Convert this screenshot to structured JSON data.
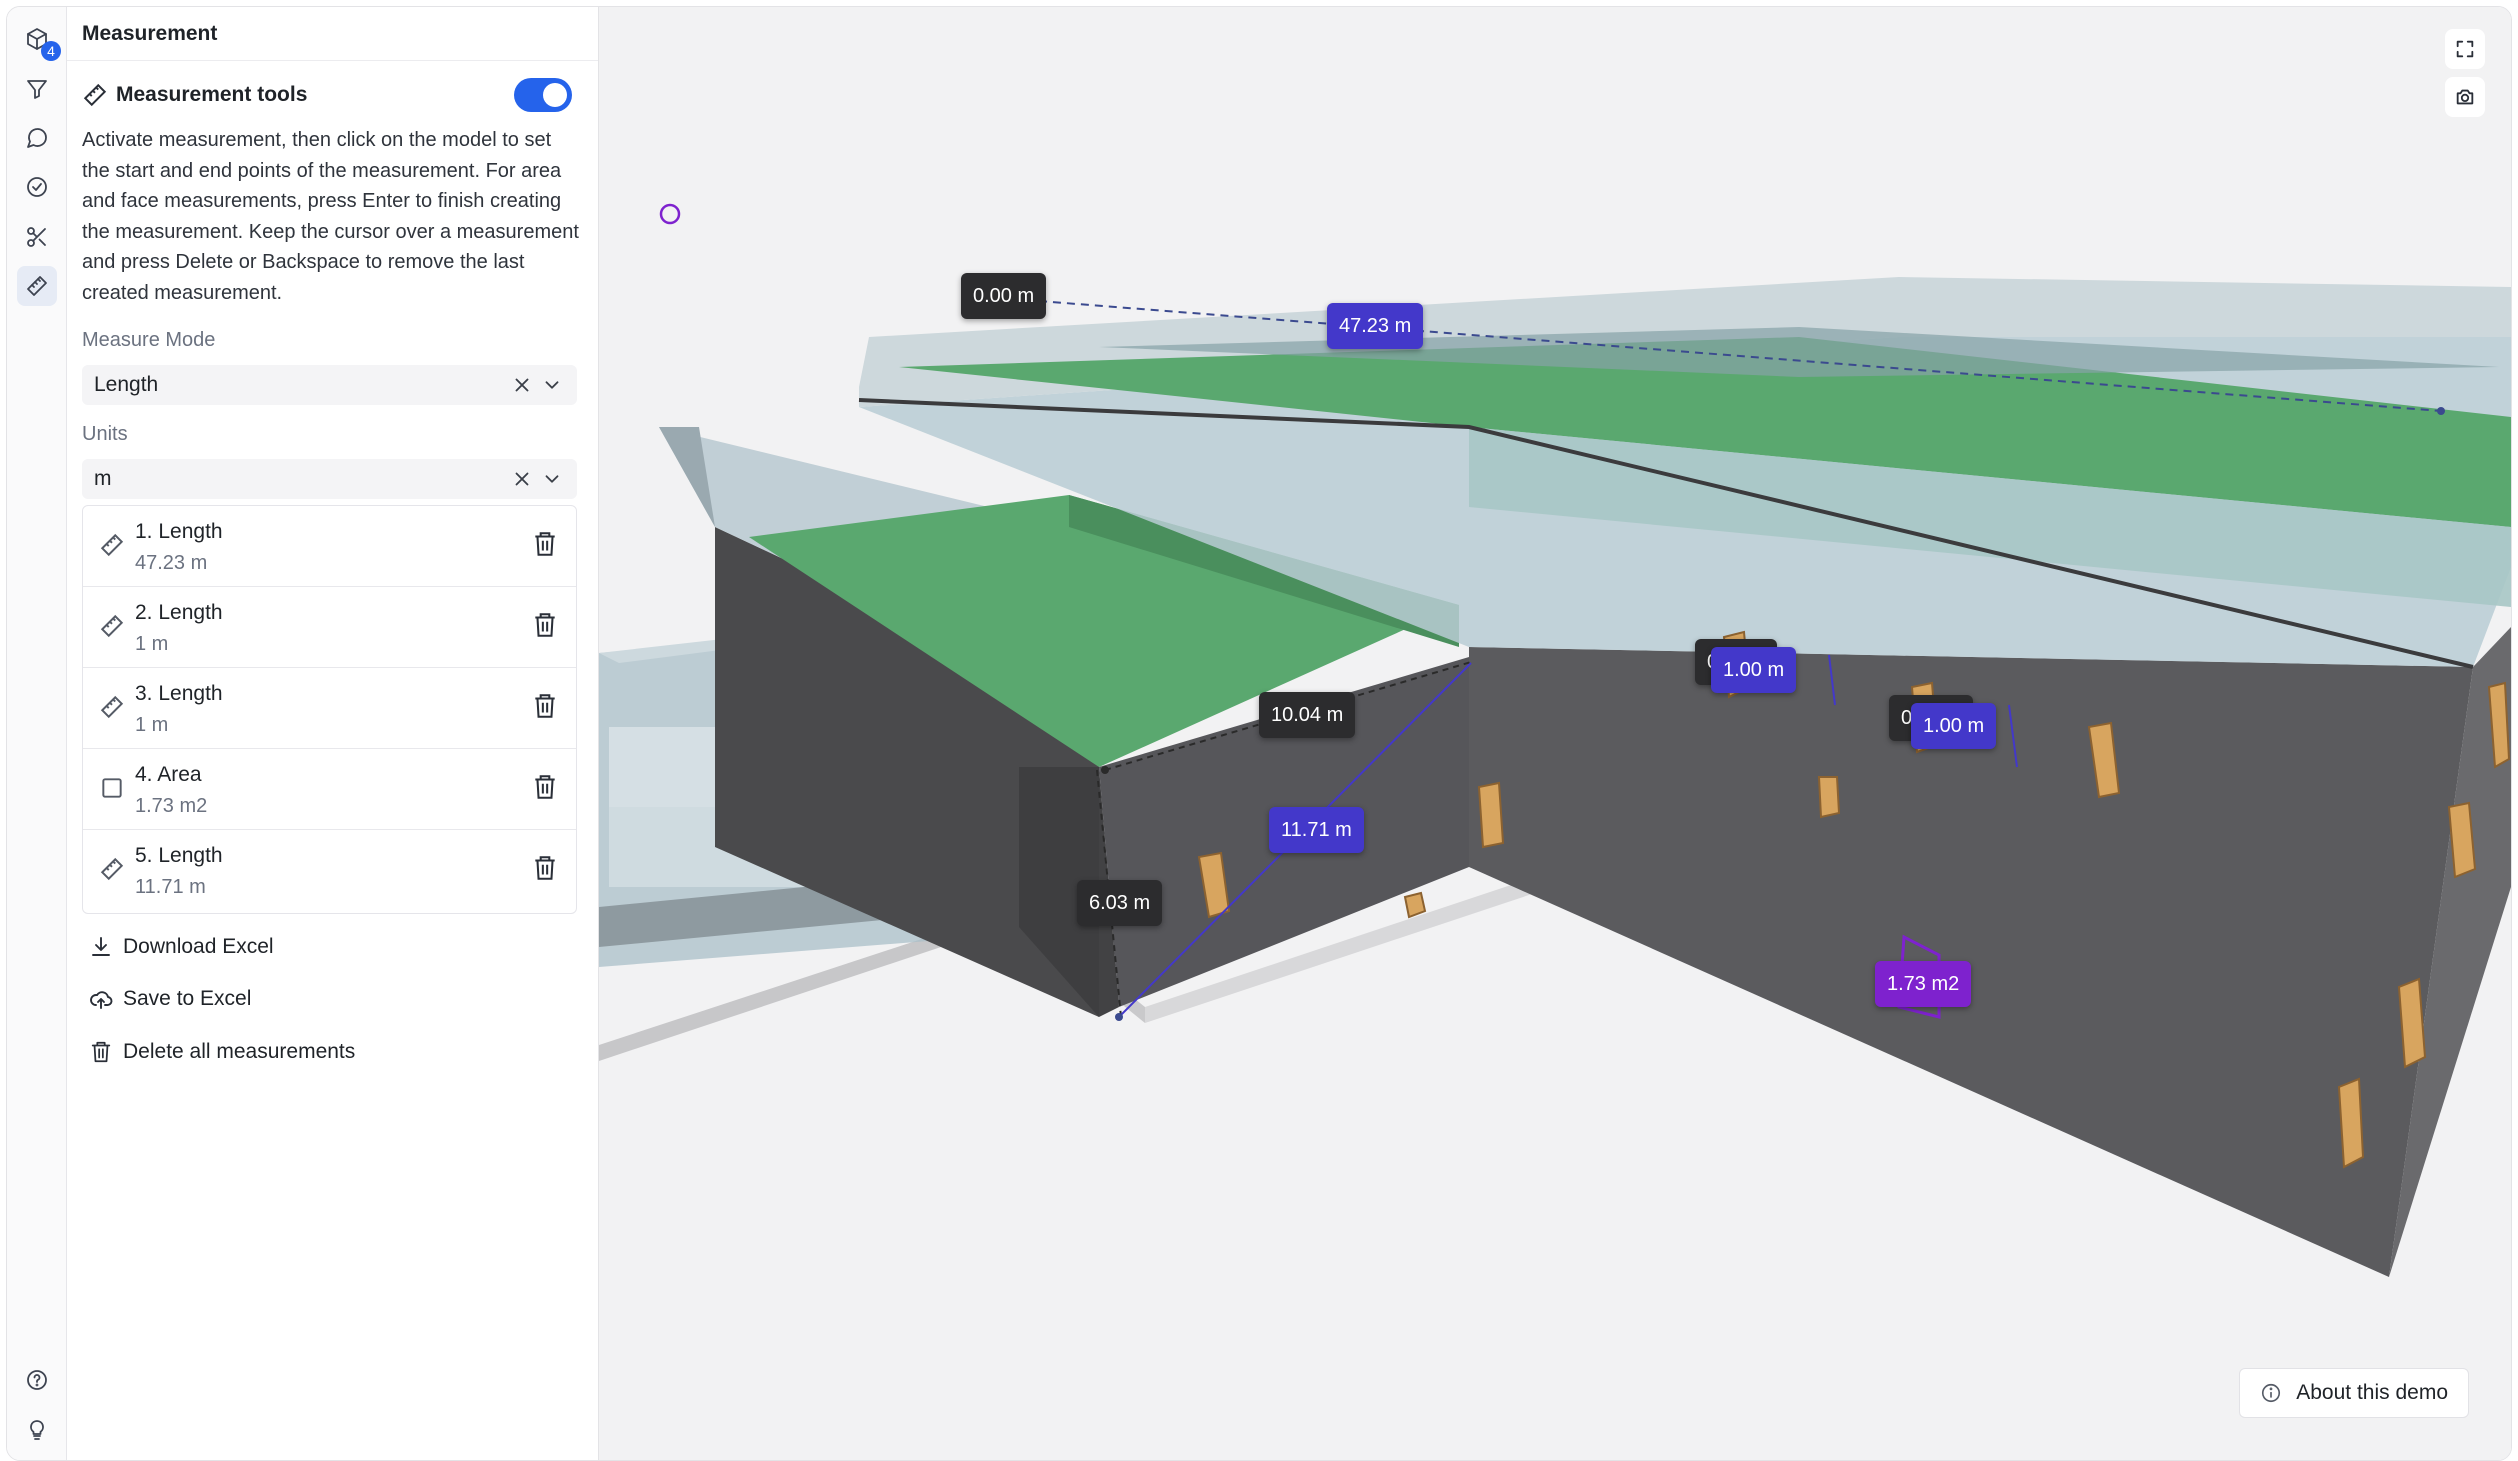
{
  "rail": {
    "model_badge": "4",
    "items": [
      "models-icon",
      "filter-icon",
      "comments-icon",
      "check-icon",
      "section-icon",
      "ruler-icon"
    ],
    "bottom": [
      "help-icon",
      "lightbulb-icon"
    ]
  },
  "panel": {
    "title": "Measurement",
    "tools_label": "Measurement tools",
    "tools_enabled": true,
    "description": "Activate measurement, then click on the model to set the start and end points of the measurement. For area and face measurements, press Enter to finish creating the measurement. Keep the cursor over a measurement and press Delete or Backspace to remove the last created measurement.",
    "mode_label": "Measure Mode",
    "mode_value": "Length",
    "units_label": "Units",
    "units_value": "m",
    "measurements": [
      {
        "name": "1. Length",
        "value": "47.23 m",
        "icon": "ruler-icon"
      },
      {
        "name": "2. Length",
        "value": "1 m",
        "icon": "ruler-icon"
      },
      {
        "name": "3. Length",
        "value": "1 m",
        "icon": "ruler-icon"
      },
      {
        "name": "4. Area",
        "value": "1.73 m2",
        "icon": "square-icon"
      },
      {
        "name": "5. Length",
        "value": "11.71 m",
        "icon": "ruler-icon"
      }
    ],
    "actions": {
      "download": "Download Excel",
      "save": "Save to Excel",
      "delete_all": "Delete all measurements"
    }
  },
  "viewport": {
    "labels": {
      "l0": "0.00 m",
      "l1": "47.23 m",
      "l2": "10.04 m",
      "l3": "11.71 m",
      "l4": "6.03 m",
      "l5a": "0",
      "l5": "1.00 m",
      "l6a": "0",
      "l6": "1.00 m",
      "l7": "1.73 m2"
    },
    "about": "About this demo",
    "colors": {
      "dark_label": "#2c2c2e",
      "blue_label": "#4338ca",
      "purple_label": "#7e22ce",
      "roof_green": "#58a96e",
      "wall_gray": "#5c5c5e"
    }
  }
}
